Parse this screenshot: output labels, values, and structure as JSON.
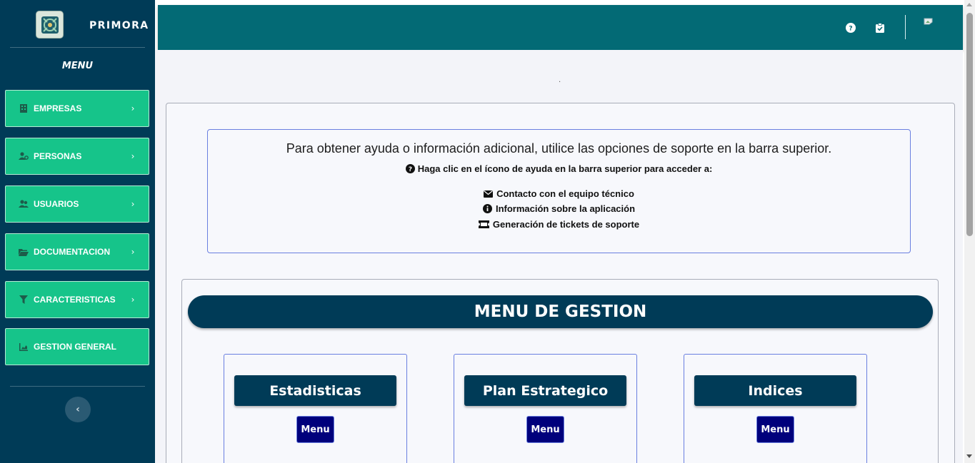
{
  "brand": {
    "name": "PRIMORA",
    "logo": "primora-logo"
  },
  "sidebar": {
    "menu_title": "MENU",
    "items": [
      {
        "label": "EMPRESAS",
        "icon": "building-icon",
        "has_chevron": true
      },
      {
        "label": "PERSONAS",
        "icon": "users-gear-icon",
        "has_chevron": true
      },
      {
        "label": "USUARIOS",
        "icon": "users-icon",
        "has_chevron": true
      },
      {
        "label": "DOCUMENTACION",
        "icon": "folder-open-icon",
        "has_chevron": true
      },
      {
        "label": "CARACTERISTICAS",
        "icon": "filter-icon",
        "has_chevron": true
      },
      {
        "label": "GESTION GENERAL",
        "icon": "chart-area-icon",
        "has_chevron": false
      }
    ],
    "collapse_icon": "chevron-left-icon"
  },
  "topbar": {
    "icons": [
      "question-circle-icon",
      "clipboard-check-icon",
      "avatar-image"
    ]
  },
  "help": {
    "title": "Para obtener ayuda o información adicional, utilice las opciones de soporte en la barra superior.",
    "subtitle": "Haga clic en el ícono de ayuda en la barra superior para acceder a:",
    "lines": [
      {
        "icon": "envelope-icon",
        "text": "Contacto con el equipo técnico"
      },
      {
        "icon": "info-circle-icon",
        "text": "Información sobre la aplicación"
      },
      {
        "icon": "ticket-icon",
        "text": "Generación de tickets de soporte"
      }
    ]
  },
  "gestion": {
    "title": "MENU DE GESTION",
    "cards": [
      {
        "title": "Estadisticas",
        "button": "Menu"
      },
      {
        "title": "Plan Estrategico",
        "button": "Menu"
      },
      {
        "title": "Indices",
        "button": "Menu"
      }
    ]
  },
  "colors": {
    "sidebar_bg": "#003b57",
    "nav_item_bg": "#16c48a",
    "topbar_bg": "#036a75",
    "main_bg": "#f3f4f9",
    "card_border": "#6a7fe0",
    "menu_button_bg": "#00007c"
  }
}
